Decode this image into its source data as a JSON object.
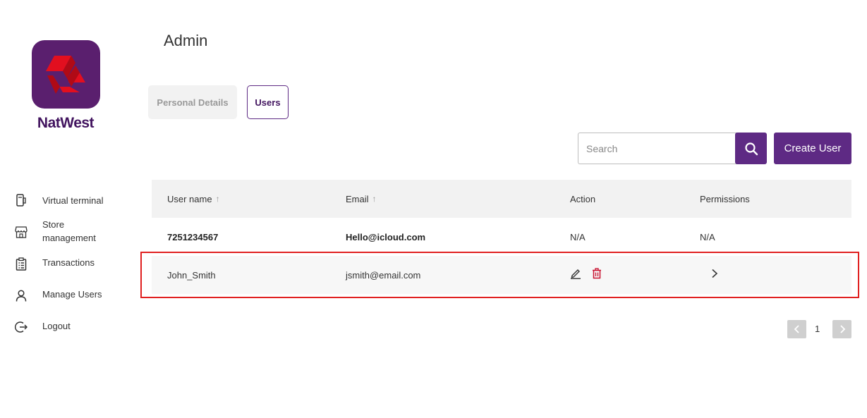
{
  "brand": {
    "name": "NatWest",
    "color": "#42145f",
    "logo_color": "#5a1f6e",
    "logo_mark_color": "#e20f1f"
  },
  "sidebar": {
    "items": [
      {
        "label": "Virtual terminal",
        "icon": "card-terminal-icon"
      },
      {
        "label": "Store management",
        "icon": "store-icon"
      },
      {
        "label": "Transactions",
        "icon": "clipboard-list-icon"
      },
      {
        "label": "Manage Users",
        "icon": "user-icon"
      },
      {
        "label": "Logout",
        "icon": "logout-icon"
      }
    ]
  },
  "header": {
    "title": "Admin"
  },
  "tabs": [
    {
      "label": "Personal Details",
      "active": false
    },
    {
      "label": "Users",
      "active": true
    }
  ],
  "search": {
    "placeholder": "Search",
    "value": ""
  },
  "toolbar": {
    "create_label": "Create User",
    "accent": "#5e2a84"
  },
  "table": {
    "columns": [
      "User name",
      "Email",
      "Action",
      "Permissions"
    ],
    "rows": [
      {
        "username": "7251234567",
        "email": "Hello@icloud.com",
        "action": "N/A",
        "permissions": "N/A"
      },
      {
        "username": "John_Smith",
        "email": "jsmith@email.com",
        "action_icons": [
          "edit-icon",
          "delete-icon"
        ],
        "permissions_icon": "chevron-right-icon"
      }
    ]
  },
  "pagination": {
    "current_page": "1"
  },
  "highlight_color": "#e02020"
}
